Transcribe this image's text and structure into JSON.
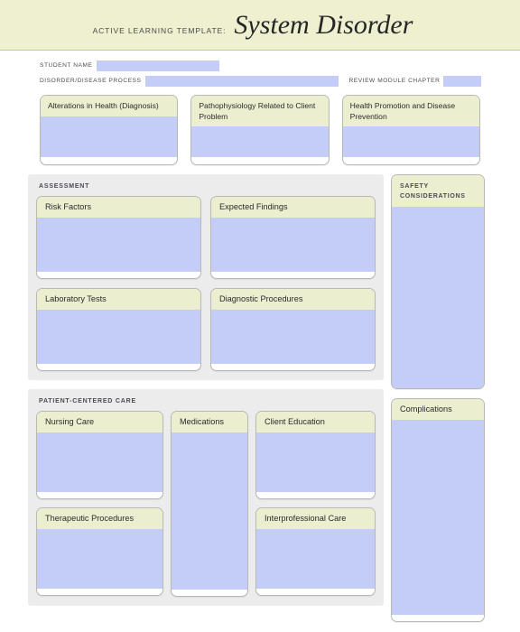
{
  "header": {
    "kicker": "ACTIVE LEARNING TEMPLATE:",
    "title": "System Disorder"
  },
  "meta": {
    "student_name_label": "STUDENT NAME",
    "student_name_value": "",
    "disorder_label": "DISORDER/DISEASE PROCESS",
    "disorder_value": "",
    "review_module_label": "REVIEW MODULE CHAPTER",
    "review_module_value": ""
  },
  "top_boxes": [
    {
      "title": "Alterations in\nHealth (Diagnosis)",
      "value": ""
    },
    {
      "title": "Pathophysiology Related\nto Client Problem",
      "value": ""
    },
    {
      "title": "Health Promotion and\nDisease Prevention",
      "value": ""
    }
  ],
  "assessment": {
    "section_title": "ASSESSMENT",
    "boxes": [
      {
        "title": "Risk Factors",
        "value": ""
      },
      {
        "title": "Expected Findings",
        "value": ""
      },
      {
        "title": "Laboratory Tests",
        "value": ""
      },
      {
        "title": "Diagnostic Procedures",
        "value": ""
      }
    ]
  },
  "patient_centered_care": {
    "section_title": "PATIENT-CENTERED CARE",
    "boxes": [
      {
        "title": "Nursing Care",
        "value": ""
      },
      {
        "title": "Therapeutic Procedures",
        "value": ""
      },
      {
        "title": "Medications",
        "value": ""
      },
      {
        "title": "Client Education",
        "value": ""
      },
      {
        "title": "Interprofessional Care",
        "value": ""
      }
    ]
  },
  "right_column": {
    "safety": {
      "title": "SAFETY CONSIDERATIONS",
      "value": ""
    },
    "complications": {
      "title": "Complications",
      "value": ""
    }
  },
  "colors": {
    "band": "#eff0d0",
    "card_header": "#eceed0",
    "fill_blue": "#c3cdf7",
    "panel_gray": "#ececec",
    "border_gray": "#b9b9b3",
    "text_dark": "#262626"
  }
}
